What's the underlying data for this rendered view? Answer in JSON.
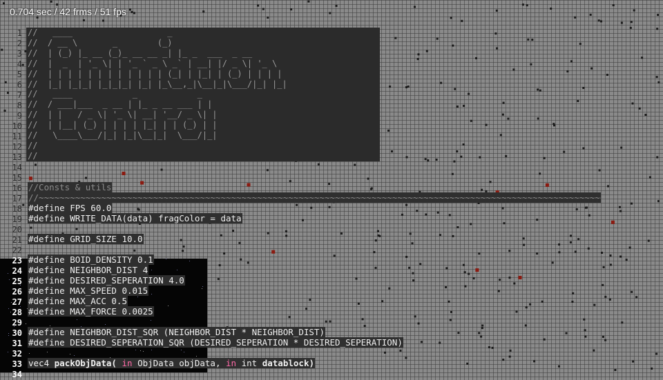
{
  "hud": {
    "fps_text": "0.704 sec / 42 frms / 51 fps"
  },
  "gutter": {
    "line_numbers": [
      "1",
      "2",
      "3",
      "4",
      "5",
      "6",
      "7",
      "8",
      "9",
      "10",
      "11",
      "12",
      "13",
      "14",
      "15",
      "16",
      "17",
      "18",
      "19",
      "20",
      "21",
      "22",
      "23",
      "24",
      "25",
      "26",
      "27",
      "28",
      "29",
      "30",
      "31",
      "32",
      "33",
      "34"
    ]
  },
  "banner": {
    "art_lines": [
      "//   ____                   _",
      "//  / __ \\       _        (_)",
      "//  | (_) |_ __ (_)_ __ __ _| |_ _  ___  _ __",
      "//  |  _  | '_ \\| | '_ ` _ \\ _` | __| |/ _ \\| '_ \\",
      "//  | | | | | | | | | | | | (_| | |_| | (_) | | | |",
      "//  |_| |_|_| |_|_|_| |_| |_\\__,_|\\__|_|\\___/|_| |_|",
      "//   ____            _            _",
      "//  / ___|___  _ __ | |_ _ __ ___ | |",
      "//  | |   / _ \\| '_ \\| __| '__/ _ \\| |",
      "//  | |__| (_) | | | | |_| | | (_) | |",
      "//   \\____\\___/|_| |_|\\__|_|  \\___/|_|",
      "//",
      "//"
    ]
  },
  "code": {
    "consts_comment": "//Consts & utils",
    "divider_comment": "//~~~~~~~~~~~~~~~~~~~~~~~~~~~~~~~~~~~~~~~~~~~~~~~~~~~~~~~~~~~~~~~~~~~~~~~~~~~~~~~~~~~~~~~~~~~~~~~~~~~~~~~~~~~~~~~~~~~~~~~",
    "line_fps": "#define FPS 60.0",
    "line_write": "#define WRITE_DATA(data) fragColor = data",
    "line_grid": "#define GRID_SIZE 10.0",
    "line_density": "#define BOID_DENSITY 0.1",
    "line_neighbor": "#define NEIGHBOR_DIST 4",
    "line_desired": "#define DESIRED_SEPERATION 4.0",
    "line_speed": "#define MAX_SPEED 0.015",
    "line_acc": "#define MAX_ACC 0.5",
    "line_force": "#define MAX_FORCE 0.0025",
    "line_neighbor_sqr": "#define NEIGHBOR_DIST_SQR (NEIGHBOR_DIST * NEIGHBOR_DIST)",
    "line_desired_sqr": "#define DESIRED_SEPERATION_SQR (DESIRED_SEPERATION * DESIRED_SEPERATION)",
    "fn_type": "vec4",
    "fn_name": "packObjData(",
    "kw_in1": "in",
    "fn_arg1": "ObjData objData,",
    "kw_in2": "in",
    "fn_arg2": "int",
    "fn_arg2_name": "datablock)"
  },
  "colors": {
    "grid_bg": "#8a8a8a",
    "editor_bg": "#2f2f2f",
    "keyword": "#ff6aa8",
    "boid": "#1a1a1a",
    "boid_red": "#8b1a10"
  }
}
